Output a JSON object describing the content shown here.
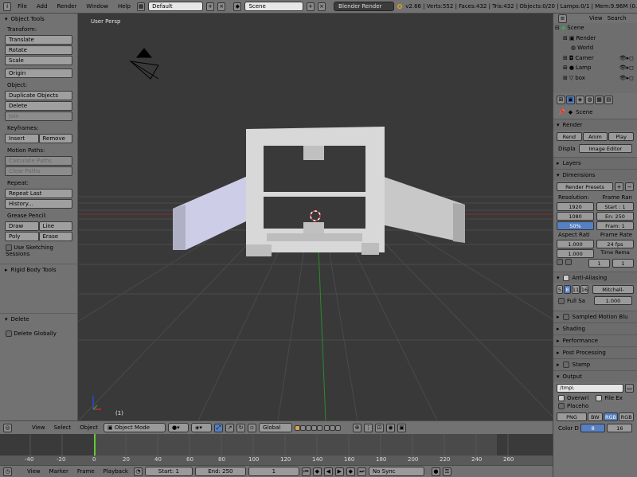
{
  "topbar": {
    "menus": [
      "File",
      "Add",
      "Render",
      "Window",
      "Help"
    ],
    "layout": "Default",
    "scene": "Scene",
    "engine": "Blender Render",
    "stats": "v2.66 | Verts:552 | Faces:432 | Tris:432 | Objects:0/20 | Lamps:0/1 | Mem:9.96M (0."
  },
  "toolshelf": {
    "title": "Object Tools",
    "transform_label": "Transform:",
    "translate": "Translate",
    "rotate": "Rotate",
    "scale": "Scale",
    "origin": "Origin",
    "object_label": "Object:",
    "duplicate": "Duplicate Objects",
    "delete": "Delete",
    "join": "Join",
    "keyframes_label": "Keyframes:",
    "insert": "Insert",
    "remove": "Remove",
    "motion_label": "Motion Paths:",
    "calc_paths": "Calculate Paths",
    "clear_paths": "Clear Paths",
    "repeat_label": "Repeat:",
    "repeat_last": "Repeat Last",
    "history": "History...",
    "grease_label": "Grease Pencil:",
    "draw": "Draw",
    "line": "Line",
    "poly": "Poly",
    "erase": "Erase",
    "sketching": "Use Sketching Sessions",
    "rigid": "Rigid Body Tools",
    "op_title": "Delete",
    "delete_globally": "Delete Globally"
  },
  "viewport": {
    "label": "User Persp",
    "frame_indicator": "(1)"
  },
  "outliner": {
    "view": "View",
    "search": "Search",
    "rows": [
      "Scene",
      "Render",
      "World",
      "Camer",
      "Lamp",
      "box"
    ]
  },
  "props": {
    "scene": "Scene",
    "render": "Render",
    "render_btn": "Rend",
    "anim_btn": "Anim",
    "play_btn": "Play",
    "display_label": "Displa",
    "display_value": "Image Editor",
    "layers": "Layers",
    "dimensions": "Dimensions",
    "render_presets": "Render Presets",
    "resolution": "Resolution:",
    "frame_range": "Frame Ran",
    "res_x": "1920",
    "res_y": "1080",
    "res_pct": "50%",
    "start": "Start : 1",
    "end": "En: 250",
    "frame": "Fram: 1",
    "aspect": "Aspect Rati",
    "frame_rate": "Frame Rate",
    "aspect_x": "1.000",
    "aspect_y": "1.000",
    "fps": "24 fps",
    "time_remap": "Time Rema",
    "remap_a": "1",
    "remap_b": "1",
    "anti_alias": "Anti-Aliasing",
    "aa_samples": [
      "8",
      "11",
      "16"
    ],
    "aa_samples_extra": "5",
    "filter": "Mitchell-",
    "full_sample": "Full Sa",
    "filter_size": "1.000",
    "sampled_motion": "Sampled Motion Blu",
    "shading": "Shading",
    "performance": "Performance",
    "post_processing": "Post Processing",
    "stamp": "Stamp",
    "output": "Output",
    "output_path": "/tmp\\",
    "overwrite": "Overwri",
    "file_ext": "File Ex",
    "placeholders": "Placeho",
    "format": "PNG",
    "bw": "BW",
    "rgb": "RGB",
    "rgba": "RGB",
    "color_depth": "Color D",
    "depth_8": "8",
    "depth_16": "16"
  },
  "vheader": {
    "view": "View",
    "select": "Select",
    "object": "Object",
    "mode": "Object Mode",
    "orientation": "Global"
  },
  "timeline": {
    "ticks": [
      "-40",
      "-20",
      "0",
      "20",
      "40",
      "60",
      "80",
      "100",
      "120",
      "140",
      "160",
      "180",
      "200",
      "220",
      "240",
      "260"
    ]
  },
  "tfooter": {
    "view": "View",
    "marker": "Marker",
    "frame": "Frame",
    "playback": "Playback",
    "start": "Start: 1",
    "end": "End: 250",
    "current": "1",
    "sync": "No Sync"
  },
  "colors": {
    "accent": "#5680c2",
    "x_axis": "#8c2a2a",
    "y_axis": "#2a8c2a",
    "current_frame": "#66cc33"
  }
}
